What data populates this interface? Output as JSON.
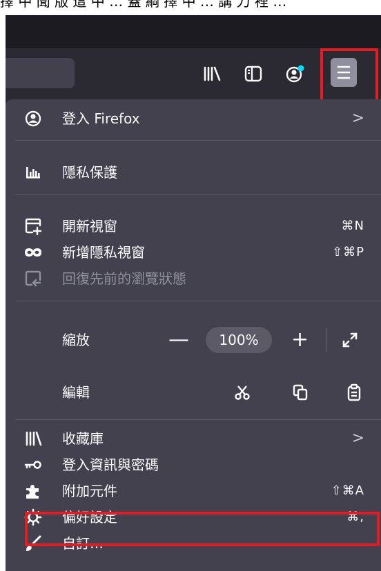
{
  "caption": {
    "text": "擇 中 聞 版 這 中 …  蓋 綱 擇 中 …  講 刀 裡 …"
  },
  "toolbar": {
    "library_icon": "library-icon",
    "sidebar_icon": "sidebar-icon",
    "account_icon": "account-icon",
    "menu_icon": "hamburger-menu-icon"
  },
  "menu": {
    "signin": {
      "label": "登入 Firefox",
      "icon": "account-circle-icon"
    },
    "privacy": {
      "label": "隱私保護",
      "icon": "chart-icon"
    },
    "new_window": {
      "label": "開新視窗",
      "shortcut": "⌘N",
      "icon": "new-window-icon"
    },
    "new_private": {
      "label": "新增隱私視窗",
      "shortcut": "⇧⌘P",
      "icon": "private-mask-icon"
    },
    "restore": {
      "label": "回復先前的瀏覽狀態",
      "icon": "restore-session-icon"
    },
    "zoom": {
      "label": "縮放",
      "minus": "—",
      "value": "100%",
      "plus": "+",
      "fullscreen_icon": "fullscreen-icon"
    },
    "edit": {
      "label": "編輯",
      "cut_icon": "scissors-icon",
      "copy_icon": "copy-icon",
      "paste_icon": "paste-icon"
    },
    "library": {
      "label": "收藏庫",
      "icon": "library-icon"
    },
    "logins": {
      "label": "登入資訊與密碼",
      "icon": "key-icon"
    },
    "addons": {
      "label": "附加元件",
      "shortcut": "⇧⌘A",
      "icon": "puzzle-icon"
    },
    "preferences": {
      "label": "偏好設定",
      "shortcut": "⌘,",
      "icon": "gear-icon"
    },
    "customize": {
      "label": "自訂…",
      "icon": "brush-icon"
    }
  },
  "colors": {
    "panel_bg": "#42414d",
    "toolbar_bg": "#2b2a33",
    "highlight_red": "#e51c23",
    "menu_button_bg": "#8f8f9d",
    "badge_blue": "#00ddff"
  }
}
